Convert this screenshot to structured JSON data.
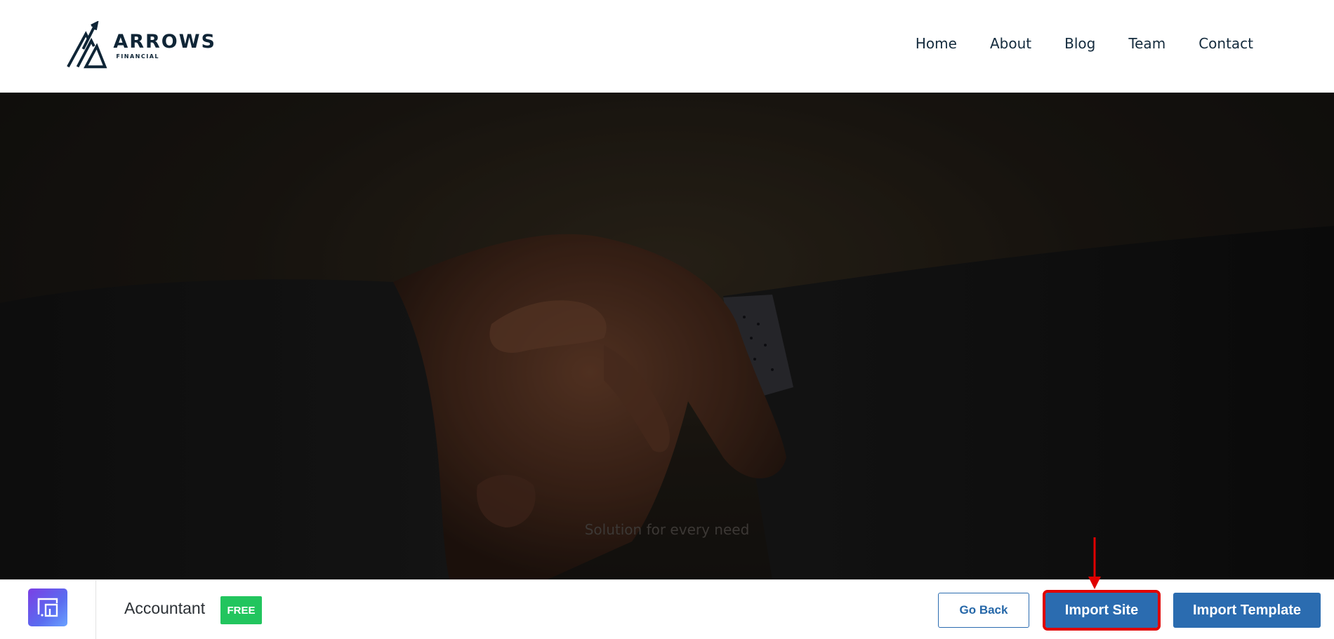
{
  "header": {
    "logo": {
      "name": "ARROWS",
      "tagline": "FINANCIAL"
    },
    "nav": [
      {
        "label": "Home"
      },
      {
        "label": "About"
      },
      {
        "label": "Blog"
      },
      {
        "label": "Team"
      },
      {
        "label": "Contact"
      }
    ]
  },
  "hero": {
    "caption": "Solution for every need"
  },
  "bottom_bar": {
    "site_title": "Accountant",
    "badge": "FREE",
    "go_back_label": "Go Back",
    "import_site_label": "Import Site",
    "import_template_label": "Import Template"
  },
  "colors": {
    "primary_button": "#2b6cb0",
    "badge_green": "#22c55e",
    "annotation_red": "#e00000",
    "nav_text": "#142b3d"
  }
}
